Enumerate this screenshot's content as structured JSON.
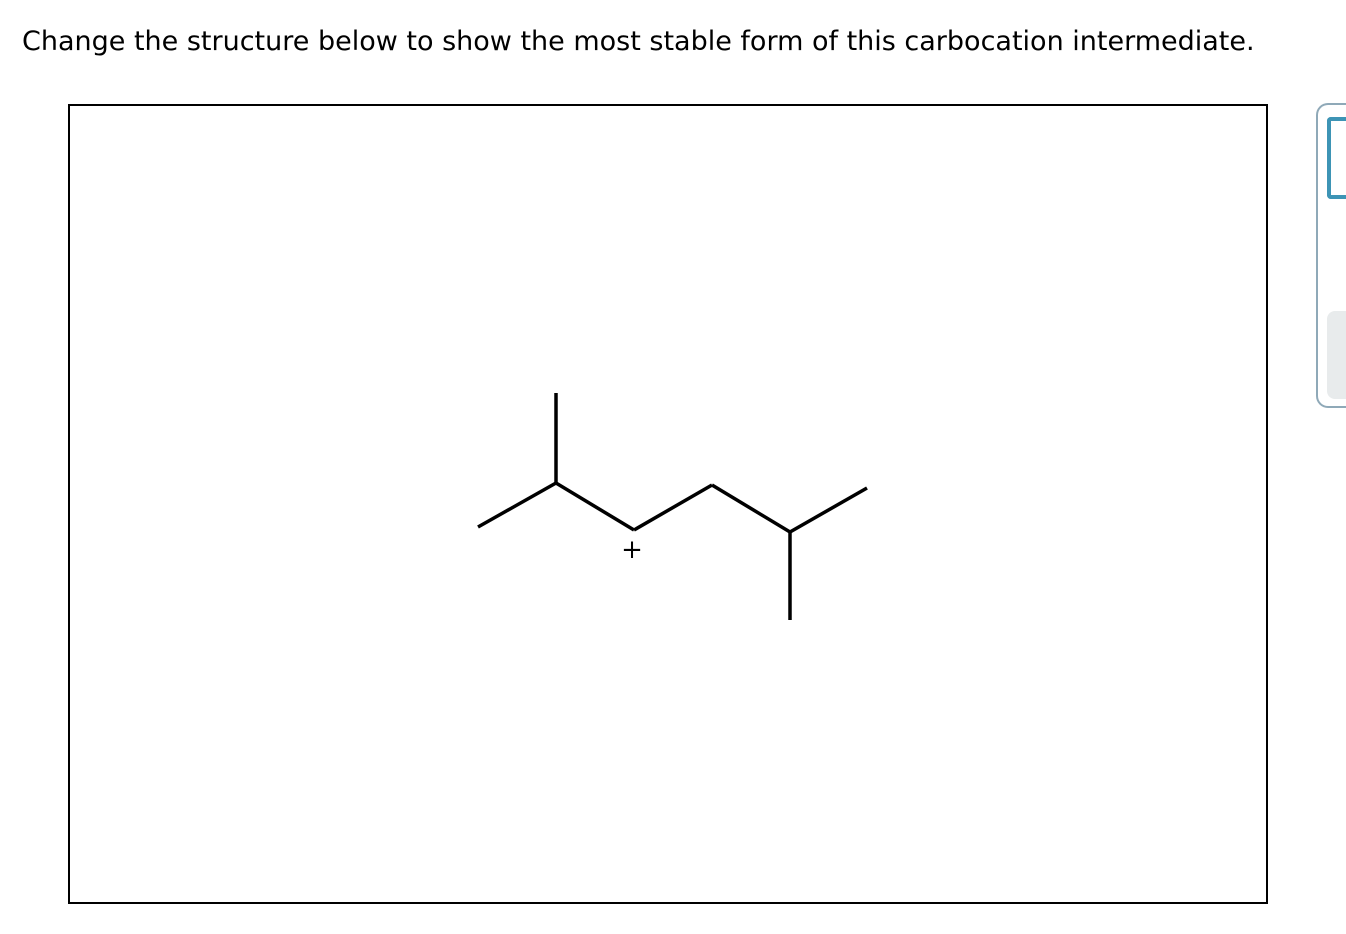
{
  "question": {
    "text": "Change the structure below to show the most stable form of this carbocation intermediate."
  },
  "molecule": {
    "charge_label": "+",
    "bond_color": "#000000"
  },
  "side_panel": {
    "border_color": "#8fa9b8",
    "accent_color": "#3d94b5",
    "button_color": "#e8ebec"
  }
}
